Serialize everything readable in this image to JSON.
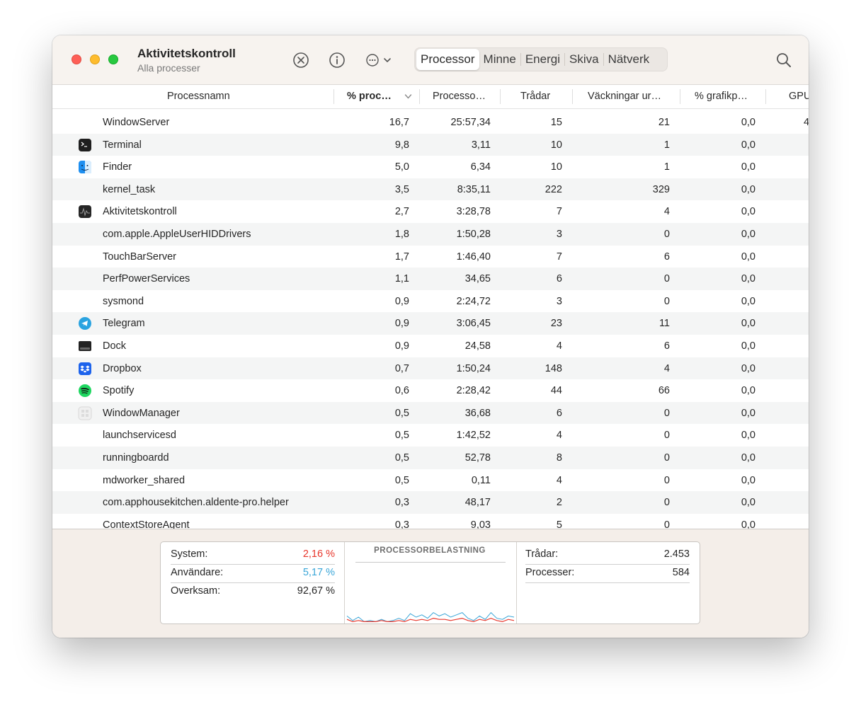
{
  "window": {
    "title": "Aktivitetskontroll",
    "subtitle": "Alla processer"
  },
  "toolbar": {
    "stop_icon": "xmark-circle-icon",
    "info_icon": "info-circle-icon",
    "more_icon": "ellipsis-circle-icon",
    "tabs": [
      "Processor",
      "Minne",
      "Energi",
      "Skiva",
      "Nätverk"
    ],
    "active_tab": "Processor",
    "search_icon": "magnifyingglass-icon"
  },
  "columns": [
    "Processnamn",
    "% proc…",
    "Processo…",
    "Trådar",
    "Väckningar ur…",
    "% grafikp…",
    "GPU"
  ],
  "processes": [
    {
      "name": "WindowServer",
      "icon": "",
      "cpu": "16,7",
      "time": "25:57,34",
      "threads": "15",
      "wakeups": "21",
      "gpu": "0,0",
      "gputime": "4"
    },
    {
      "name": "Terminal",
      "icon": "terminal-app-icon",
      "cpu": "9,8",
      "time": "3,11",
      "threads": "10",
      "wakeups": "1",
      "gpu": "0,0",
      "gputime": ""
    },
    {
      "name": "Finder",
      "icon": "finder-app-icon",
      "cpu": "5,0",
      "time": "6,34",
      "threads": "10",
      "wakeups": "1",
      "gpu": "0,0",
      "gputime": ""
    },
    {
      "name": "kernel_task",
      "icon": "",
      "cpu": "3,5",
      "time": "8:35,11",
      "threads": "222",
      "wakeups": "329",
      "gpu": "0,0",
      "gputime": ""
    },
    {
      "name": "Aktivitetskontroll",
      "icon": "activity-monitor-app-icon",
      "cpu": "2,7",
      "time": "3:28,78",
      "threads": "7",
      "wakeups": "4",
      "gpu": "0,0",
      "gputime": ""
    },
    {
      "name": "com.apple.AppleUserHIDDrivers",
      "icon": "",
      "cpu": "1,8",
      "time": "1:50,28",
      "threads": "3",
      "wakeups": "0",
      "gpu": "0,0",
      "gputime": ""
    },
    {
      "name": "TouchBarServer",
      "icon": "",
      "cpu": "1,7",
      "time": "1:46,40",
      "threads": "7",
      "wakeups": "6",
      "gpu": "0,0",
      "gputime": ""
    },
    {
      "name": "PerfPowerServices",
      "icon": "",
      "cpu": "1,1",
      "time": "34,65",
      "threads": "6",
      "wakeups": "0",
      "gpu": "0,0",
      "gputime": ""
    },
    {
      "name": "sysmond",
      "icon": "",
      "cpu": "0,9",
      "time": "2:24,72",
      "threads": "3",
      "wakeups": "0",
      "gpu": "0,0",
      "gputime": ""
    },
    {
      "name": "Telegram",
      "icon": "telegram-app-icon",
      "cpu": "0,9",
      "time": "3:06,45",
      "threads": "23",
      "wakeups": "11",
      "gpu": "0,0",
      "gputime": ""
    },
    {
      "name": "Dock",
      "icon": "dock-app-icon",
      "cpu": "0,9",
      "time": "24,58",
      "threads": "4",
      "wakeups": "6",
      "gpu": "0,0",
      "gputime": ""
    },
    {
      "name": "Dropbox",
      "icon": "dropbox-app-icon",
      "cpu": "0,7",
      "time": "1:50,24",
      "threads": "148",
      "wakeups": "4",
      "gpu": "0,0",
      "gputime": ""
    },
    {
      "name": "Spotify",
      "icon": "spotify-app-icon",
      "cpu": "0,6",
      "time": "2:28,42",
      "threads": "44",
      "wakeups": "66",
      "gpu": "0,0",
      "gputime": ""
    },
    {
      "name": "WindowManager",
      "icon": "windowmanager-app-icon",
      "cpu": "0,5",
      "time": "36,68",
      "threads": "6",
      "wakeups": "0",
      "gpu": "0,0",
      "gputime": ""
    },
    {
      "name": "launchservicesd",
      "icon": "",
      "cpu": "0,5",
      "time": "1:42,52",
      "threads": "4",
      "wakeups": "0",
      "gpu": "0,0",
      "gputime": ""
    },
    {
      "name": "runningboardd",
      "icon": "",
      "cpu": "0,5",
      "time": "52,78",
      "threads": "8",
      "wakeups": "0",
      "gpu": "0,0",
      "gputime": ""
    },
    {
      "name": "mdworker_shared",
      "icon": "",
      "cpu": "0,5",
      "time": "0,11",
      "threads": "4",
      "wakeups": "0",
      "gpu": "0,0",
      "gputime": ""
    },
    {
      "name": "com.apphousekitchen.aldente-pro.helper",
      "icon": "",
      "cpu": "0,3",
      "time": "48,17",
      "threads": "2",
      "wakeups": "0",
      "gpu": "0,0",
      "gputime": ""
    },
    {
      "name": "ContextStoreAgent",
      "icon": "",
      "cpu": "0,3",
      "time": "9,03",
      "threads": "5",
      "wakeups": "0",
      "gpu": "0,0",
      "gputime": ""
    }
  ],
  "summary": {
    "system_label": "System:",
    "system_value": "2,16 %",
    "user_label": "Användare:",
    "user_value": "5,17 %",
    "idle_label": "Overksam:",
    "idle_value": "92,67 %",
    "graph_title": "PROCESSORBELASTNING",
    "threads_label": "Trådar:",
    "threads_value": "2.453",
    "processes_label": "Processer:",
    "processes_value": "584"
  },
  "colors": {
    "system": "#e8372c",
    "user": "#3aa6d8",
    "close": "#fe5f57",
    "minimize": "#febc2e",
    "zoom": "#28c840"
  }
}
